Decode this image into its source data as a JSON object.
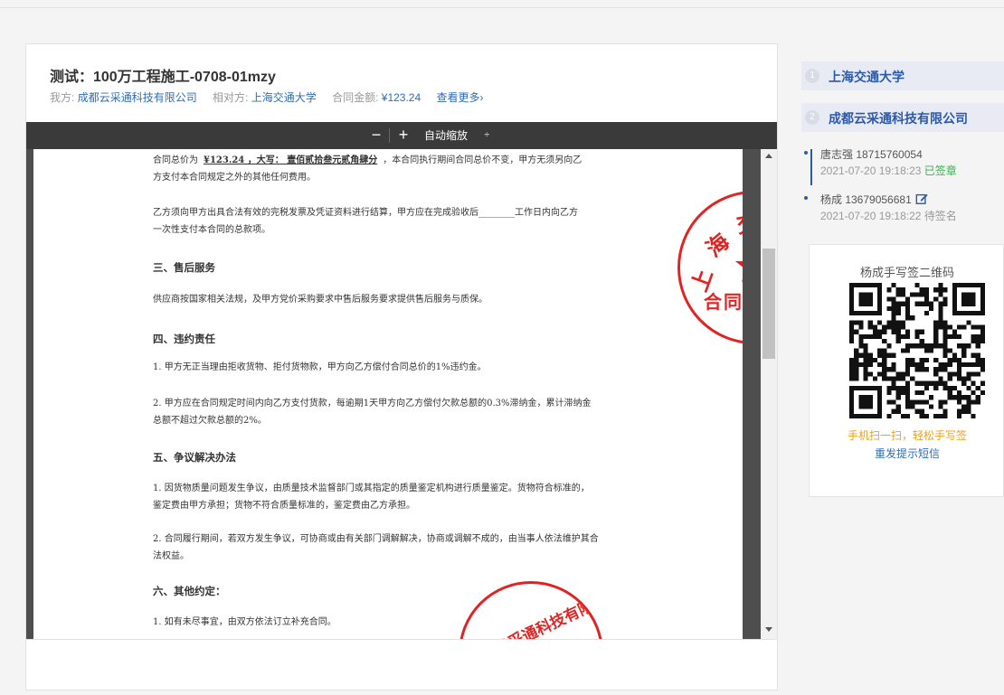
{
  "header": {
    "title": "测试：100万工程施工-0708-01mzy",
    "my_side_label": "我方:",
    "my_side_value": "成都云采通科技有限公司",
    "counterparty_label": "相对方:",
    "counterparty_value": "上海交通大学",
    "amount_label": "合同金额:",
    "amount_value": "¥123.24",
    "view_more": "查看更多›"
  },
  "toolbar": {
    "zoom_out": "−",
    "zoom_in": "+",
    "zoom_select": "自动缩放",
    "zoom_select_arrow": "÷"
  },
  "document": {
    "p1a": "合同总价为",
    "p1b": "¥123.24  ，大写：  壹佰贰拾叁元贰角肆分",
    "p1c": "，本合同执行期间合同总价不变，甲方无须另向乙",
    "p1d": "方支付本合同规定之外的其他任何费用。",
    "p2a": "乙方须向甲方出具合法有效的完税发票及凭证资料进行结算，甲方应在完成验收后________工作日内向乙方",
    "p2b": "一次性支付本合同的总款项。",
    "h3": "三、售后服务",
    "p3": "供应商按国家相关法规，及甲方党价采购要求中售后服务要求提供售后服务与质保。",
    "h4": "四、违约责任",
    "p4": "1. 甲方无正当理由拒收货物、拒付货物款，甲方向乙方偿付合同总价的1%违约金。",
    "p5a": "2. 甲方应在合同规定时间内向乙方支付货款，每逾期1天甲方向乙方偿付欠款总额的0.3%滞纳金，累计滞纳金",
    "p5b": "总额不超过欠款总额的2%。",
    "h5": "五、争议解决办法",
    "p6a": "1. 因货物质量问题发生争议，由质量技术监督部门或其指定的质量鉴定机构进行质量鉴定。货物符合标准的，",
    "p6b": "鉴定费由甲方承担；货物不符合质量标准的，鉴定费由乙方承担。",
    "p7a": "2. 合同履行期间，若双方发生争议，可协商或由有关部门调解解决，协商或调解不成的，由当事人依法维护其合",
    "p7b": "法权益。",
    "h6": "六、其他约定：",
    "p8": "1. 如有未尽事宜，由双方依法订立补充合同。"
  },
  "stamps": {
    "stamp1_chars": [
      "上",
      "海",
      "交",
      "合",
      "同",
      "专"
    ],
    "stamp2_text": "都云采通科技有限公"
  },
  "parties": [
    {
      "num": "1",
      "name": "上海交通大学"
    },
    {
      "num": "2",
      "name": "成都云采通科技有限公司"
    }
  ],
  "signers": [
    {
      "name_phone": "唐志强 18715760054",
      "time": "2021-07-20 19:18:23",
      "status": "已签章"
    },
    {
      "name_phone": "杨成 13679056681",
      "time": "2021-07-20 19:18:22",
      "status": "待签名"
    }
  ],
  "qr": {
    "title": "杨成手写签二维码",
    "hint": "手机扫一扫，轻松手写签",
    "resend": "重发提示短信"
  },
  "colors": {
    "link_blue": "#2d6db5",
    "party_blue": "#2d5aa8",
    "signed_green": "#37b24d",
    "hint_orange": "#f0a020",
    "stamp_red": "#e02424"
  }
}
